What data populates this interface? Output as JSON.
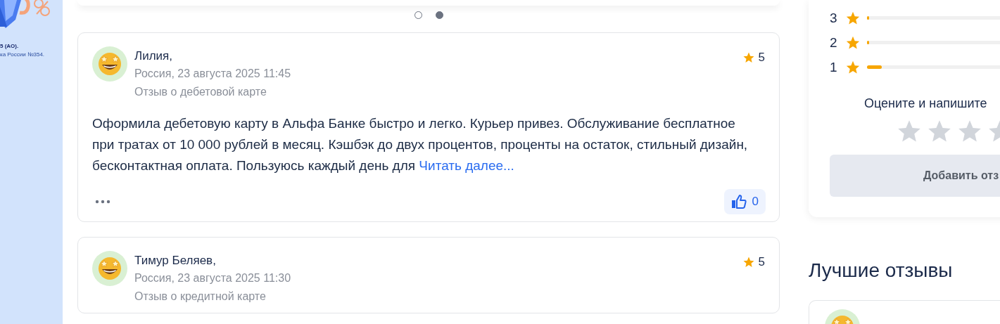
{
  "banner": {
    "lines": [
      {
        "text": "5 (АО).",
        "kind": "strong"
      },
      {
        "text": "ка России №354.",
        "kind": "plain"
      }
    ]
  },
  "carousel": {
    "dots": [
      {
        "selected": false
      },
      {
        "selected": true
      }
    ]
  },
  "reviews": [
    {
      "author": "Лилия,",
      "meta": "Россия, 23 августа 2025 11:45",
      "subject": "Отзыв о дебетовой карте",
      "rating": "5",
      "text": "Оформила дебетовую карту в Альфа Банке быстро и легко. Курьер привез. Обслуживание бесплатное при тратах от 10 000 рублей в месяц. Кэшбэк до двух процентов, проценты на остаток, стильный дизайн, бесконтактная оплата. Пользуюсь каждый день для",
      "read_more": "Читать далее...",
      "likes": "0"
    },
    {
      "author": "Тимур Беляев,",
      "meta": "Россия, 23 августа 2025 11:30",
      "subject": "Отзыв о кредитной карте",
      "rating": "5"
    }
  ],
  "rating_summary": {
    "rows": [
      {
        "label": "3",
        "level": 0.008
      },
      {
        "label": "2",
        "level": 0.008
      },
      {
        "label": "1",
        "level": 0.1
      }
    ],
    "prompt": "Оцените и напишите",
    "stars": 0,
    "button": "Добавить отз"
  },
  "best_reviews": {
    "title": "Лучшие отзывы"
  }
}
